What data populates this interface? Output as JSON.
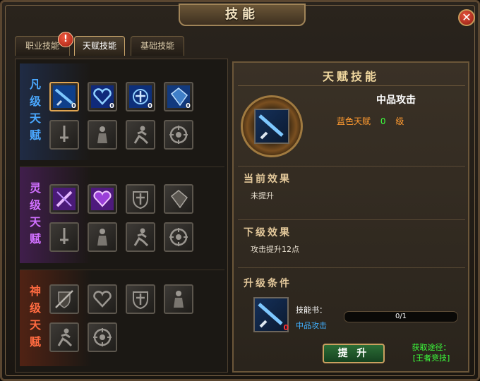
{
  "window": {
    "title": "技能",
    "close_icon": "close-icon"
  },
  "tabs": [
    {
      "label": "职业技能",
      "active": false,
      "alert": "!"
    },
    {
      "label": "天赋技能",
      "active": true
    },
    {
      "label": "基础技能",
      "active": false
    }
  ],
  "sections": [
    {
      "label": "凡级天赋",
      "color": "#4aa8ff",
      "slots": [
        {
          "icon": "blue-sword-icon",
          "count": "0",
          "selected": true
        },
        {
          "icon": "blue-heart-icon",
          "count": "0"
        },
        {
          "icon": "blue-shield-cross-icon",
          "count": "0"
        },
        {
          "icon": "blue-armor-icon",
          "count": "0"
        },
        {
          "icon": "locked-sword-icon"
        },
        {
          "icon": "locked-warrior-icon"
        },
        {
          "icon": "locked-runner-icon"
        },
        {
          "icon": "locked-target-icon"
        }
      ]
    },
    {
      "label": "灵级天赋",
      "color": "#d070ff",
      "slots": [
        {
          "icon": "purple-sword-icon"
        },
        {
          "icon": "purple-heart-icon"
        },
        {
          "icon": "locked-shield-cross-icon"
        },
        {
          "icon": "locked-armor-icon"
        },
        {
          "icon": "locked-sword-icon"
        },
        {
          "icon": "locked-warrior-icon"
        },
        {
          "icon": "locked-runner-icon"
        },
        {
          "icon": "locked-target-icon"
        }
      ]
    },
    {
      "label": "神级天赋",
      "color": "#ff6a40",
      "slots": [
        {
          "icon": "locked-shield-sword-icon"
        },
        {
          "icon": "locked-heart-icon"
        },
        {
          "icon": "locked-shield-cross-icon"
        },
        {
          "icon": "locked-warrior-icon"
        },
        {
          "icon": "locked-runner-icon"
        },
        {
          "icon": "locked-target-icon"
        }
      ]
    }
  ],
  "detail": {
    "title": "天赋技能",
    "skill_name": "中品攻击",
    "talent_type": "蓝色天赋",
    "level": "0",
    "level_unit": "级",
    "current_effect_heading": "当前效果",
    "current_effect": "未提升",
    "next_effect_heading": "下级效果",
    "next_effect": "攻击提升12点",
    "upgrade_heading": "升级条件",
    "book_label": "技能书：",
    "book_name": "中品攻击",
    "book_count": "0",
    "progress": "0/1",
    "progress_fraction": 0,
    "upgrade_button": "提 升",
    "acquire_label": "获取途径：",
    "acquire_source": "[王者竞技]"
  }
}
